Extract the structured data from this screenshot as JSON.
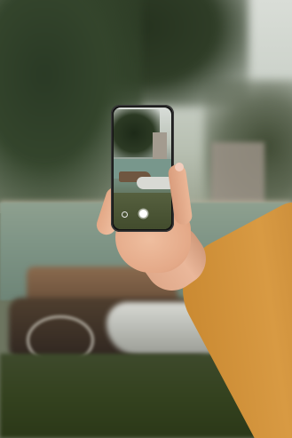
{
  "scene": {
    "subject": "hand-holding-smartphone",
    "background": "park-lake-with-rowboats",
    "colors": {
      "sleeve": "#d89a43",
      "skin": "#eab79a",
      "phone_body": "#121212",
      "water": "#7f9586",
      "grass": "#34421f"
    }
  },
  "phone": {
    "mode": "camera-viewfinder",
    "controls": {
      "shutter_icon": "circle-shutter",
      "switch_icon": "camera-switch"
    }
  }
}
